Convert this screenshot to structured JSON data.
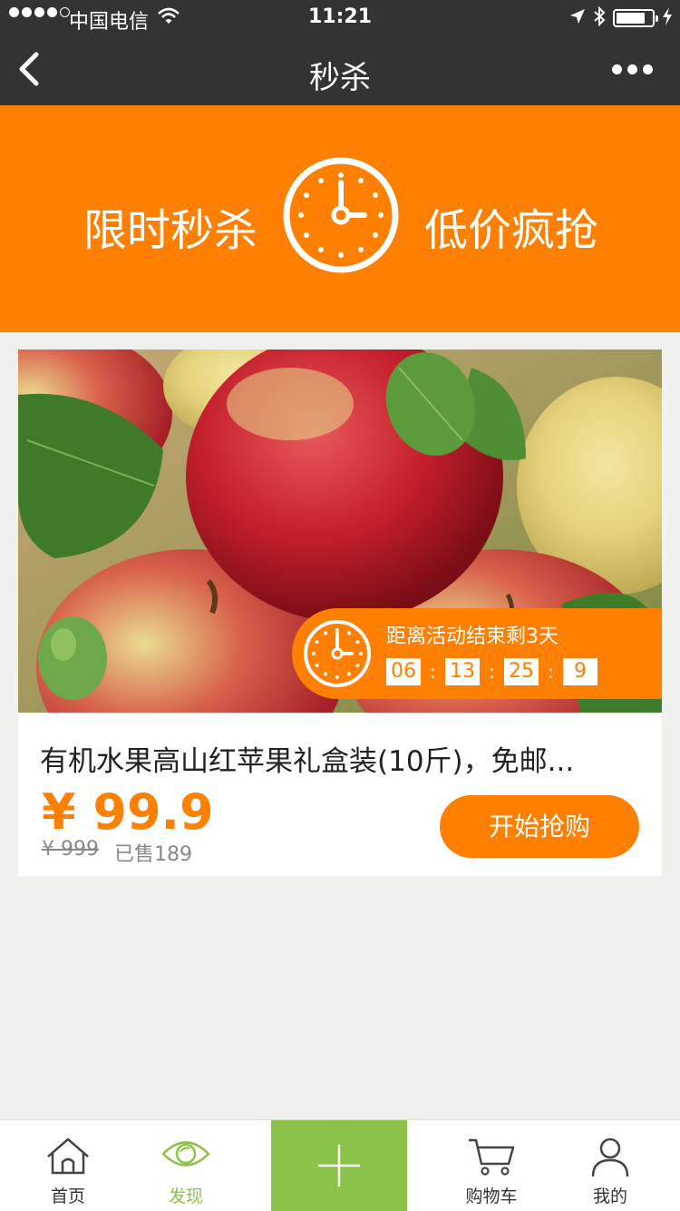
{
  "status_bar": {
    "carrier": "中国电信",
    "time": "11:21",
    "battery_level": 0.82
  },
  "nav": {
    "title": "秒杀",
    "back_icon": "chevron-left-icon",
    "more_icon": "more-dots-icon"
  },
  "banner": {
    "left_text": "限时秒杀",
    "right_text": "低价疯抢",
    "icon": "clock-icon",
    "color": "#ff7f00"
  },
  "product": {
    "image_icon": "apples-photo",
    "countdown_label": "距离活动结束剩3天",
    "countdown": [
      "06",
      "13",
      "25",
      "9"
    ],
    "countdown_separator": ":",
    "title": "有机水果高山红苹果礼盒装(10斤)，免邮...",
    "price": "¥ 99.9",
    "original_price": "¥ 999",
    "sold": "已售189",
    "buy_label": "开始抢购"
  },
  "tabbar": {
    "accent": "#8bc34a",
    "items": [
      {
        "label": "首页",
        "icon": "home-icon"
      },
      {
        "label": "发现",
        "icon": "eye-icon",
        "active": true
      },
      {
        "label": "",
        "icon": "plus-icon"
      },
      {
        "label": "购物车",
        "icon": "cart-icon"
      },
      {
        "label": "我的",
        "icon": "user-icon"
      }
    ]
  }
}
